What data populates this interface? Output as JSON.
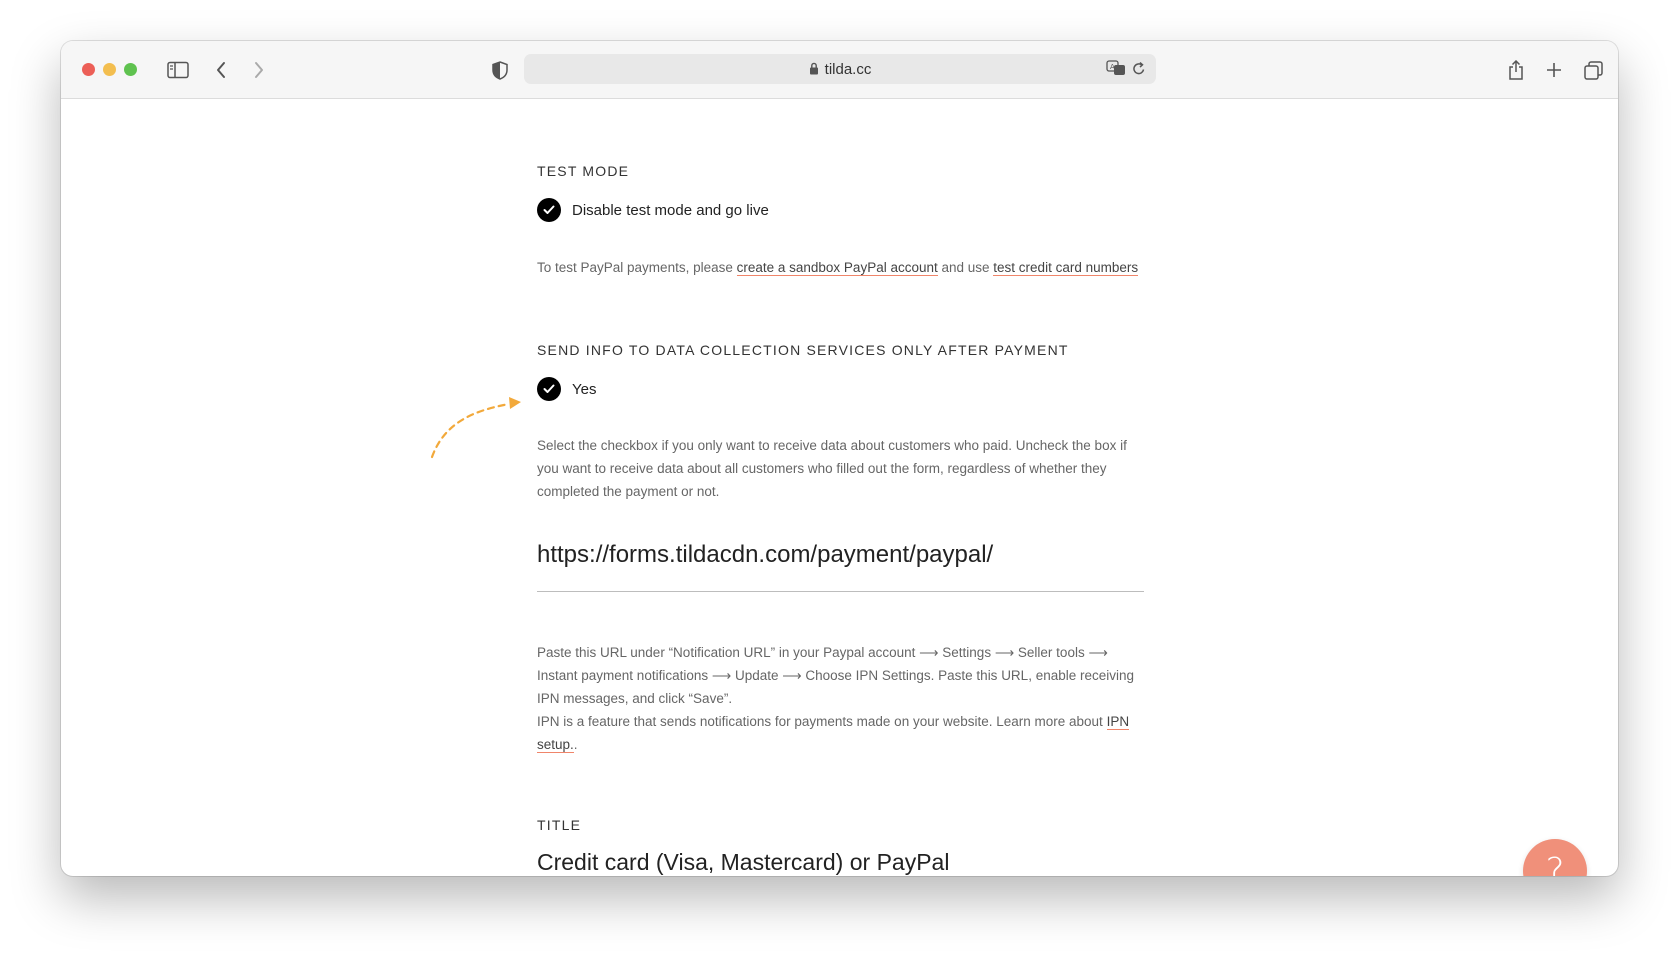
{
  "browser": {
    "address": "tilda.cc",
    "icons": [
      "sidebar-icon",
      "back-icon",
      "forward-icon",
      "shield-icon",
      "lock-icon",
      "translate-icon",
      "reload-icon",
      "share-icon",
      "new-tab-icon",
      "tabs-icon"
    ]
  },
  "test_mode": {
    "label": "TEST MODE",
    "checkbox_label": "Disable test mode and go live",
    "checked": true,
    "hint_prefix": "To test PayPal payments, please ",
    "link1": "create a sandbox PayPal account",
    "hint_middle": " and use ",
    "link2": "test credit card numbers"
  },
  "send_info": {
    "label": "SEND INFO TO DATA COLLECTION SERVICES ONLY AFTER PAYMENT",
    "checkbox_label": "Yes",
    "checked": true,
    "hint": "Select the checkbox if you only want to receive data about customers who paid. Uncheck the box if you want to receive data about all customers who filled out the form, regardless of whether they completed the payment or not."
  },
  "notification_url": {
    "value": "https://forms.tildacdn.com/payment/paypal/",
    "hint1": "Paste this URL under “Notification URL” in your Paypal account ⟶ Settings ⟶ Seller tools ⟶ Instant payment notifications ⟶ Update ⟶ Choose IPN Settings. Paste this URL, enable receiving IPN messages, and click “Save”.",
    "hint2_prefix": "IPN is a feature that sends notifications for payments made on your website. Learn more about ",
    "link": "IPN setup.",
    "hint2_suffix": "."
  },
  "title_field": {
    "label": "TITLE",
    "value": "Credit card (Visa, Mastercard) or PayPal"
  },
  "help_button": {
    "label": "?"
  },
  "colors": {
    "accent": "#f0907a",
    "arrow": "#f2a93b",
    "link_underline": "#f0856a"
  }
}
